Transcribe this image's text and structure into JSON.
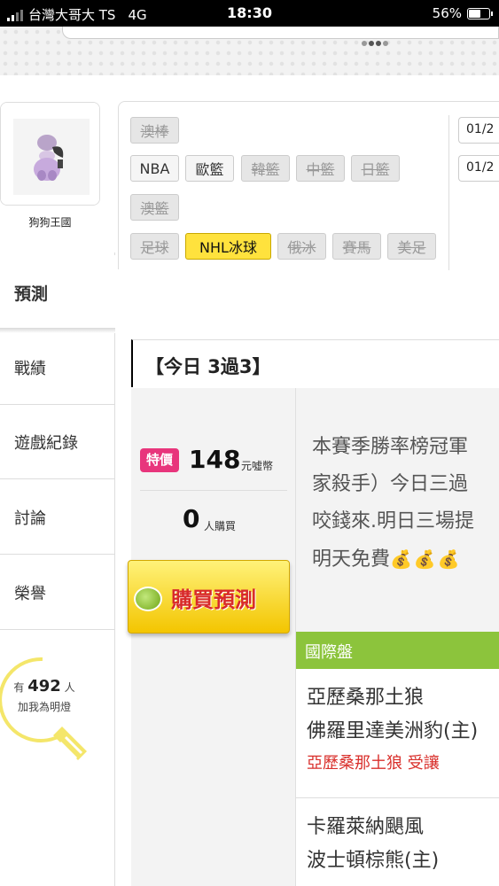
{
  "status_bar": {
    "carrier": "台灣大哥大 TS",
    "network": "4G",
    "time": "18:30",
    "battery": "56%"
  },
  "profile": {
    "name": "狗狗王國"
  },
  "menu": {
    "items": [
      {
        "label": "預測",
        "active": true
      },
      {
        "label": "戰績"
      },
      {
        "label": "遊戲紀錄"
      },
      {
        "label": "討論"
      },
      {
        "label": "榮譽"
      }
    ]
  },
  "fans": {
    "prefix": "有",
    "count": "492",
    "suffix": "人",
    "caption": "加我為明燈"
  },
  "leagues": {
    "row1": [
      {
        "label": "澳棒",
        "state": "disabled"
      }
    ],
    "row2": [
      {
        "label": "NBA",
        "state": "enabled"
      },
      {
        "label": "歐籃",
        "state": "enabled"
      },
      {
        "label": "韓籃",
        "state": "disabled"
      },
      {
        "label": "中籃",
        "state": "disabled"
      },
      {
        "label": "日籃",
        "state": "disabled"
      }
    ],
    "row3": [
      {
        "label": "澳籃",
        "state": "disabled"
      }
    ],
    "row4": [
      {
        "label": "足球",
        "state": "disabled"
      },
      {
        "label": "NHL冰球",
        "state": "active"
      },
      {
        "label": "俄冰",
        "state": "disabled"
      },
      {
        "label": "賽馬",
        "state": "disabled"
      },
      {
        "label": "美足",
        "state": "disabled"
      }
    ],
    "dates": [
      "01/2",
      "01/2"
    ]
  },
  "today": {
    "title": "【今日 3過3】"
  },
  "offer": {
    "badge": "特價",
    "price": "148",
    "price_unit": "元噓幣",
    "buyers": "0",
    "buyers_unit": "人購買",
    "buy_button": "購買預測"
  },
  "description": {
    "lines": [
      "本賽季勝率榜冠軍",
      "家殺手）今日三過",
      "咬錢來.明日三場提",
      "明天免費"
    ],
    "coins": "💰💰💰"
  },
  "market": {
    "title": "國際盤",
    "games": [
      {
        "home": "亞歷桑那土狼",
        "away": "佛羅里達美洲豹(主)",
        "note": "亞歷桑那土狼 受讓"
      },
      {
        "home": "卡羅萊納颶風",
        "away": "波士頓棕熊(主)"
      }
    ]
  },
  "colors": {
    "accent_green": "#8cc43c",
    "active_tag": "#ffe23d",
    "price_badge": "#e8357c",
    "note_red": "#d9302c"
  }
}
